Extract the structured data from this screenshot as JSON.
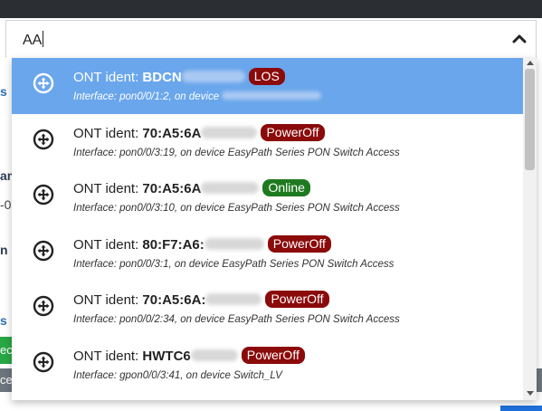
{
  "search": {
    "value": "AA"
  },
  "background": {
    "frag1": "s",
    "frag2": "am",
    "frag3": "-0(",
    "frag4": "n ",
    "frag5": "s",
    "green_btn": "ec",
    "grey_btn": "ce"
  },
  "results": [
    {
      "prefix": "ONT ident: ",
      "ident": "BDCN",
      "status": "LOS",
      "status_type": "los",
      "interface": "Interface: pon0/0/1:2, on device ",
      "active": true
    },
    {
      "prefix": "ONT ident: ",
      "ident": "70:A5:6A",
      "status": "PowerOff",
      "status_type": "poweroff",
      "interface": "Interface: pon0/0/3:19, on device EasyPath Series PON Switch Access",
      "active": false
    },
    {
      "prefix": "ONT ident: ",
      "ident": "70:A5:6A",
      "status": "Online",
      "status_type": "online",
      "interface": "Interface: pon0/0/3:10, on device EasyPath Series PON Switch Access",
      "active": false
    },
    {
      "prefix": "ONT ident: ",
      "ident": "80:F7:A6:",
      "status": "PowerOff",
      "status_type": "poweroff",
      "interface": "Interface: pon0/0/3:1, on device EasyPath Series PON Switch Access",
      "active": false
    },
    {
      "prefix": "ONT ident: ",
      "ident": "70:A5:6A:",
      "status": "PowerOff",
      "status_type": "poweroff",
      "interface": "Interface: pon0/0/2:34, on device EasyPath Series PON Switch Access",
      "active": false
    },
    {
      "prefix": "ONT ident: ",
      "ident": "HWTC6",
      "status": "PowerOff",
      "status_type": "poweroff",
      "interface": "Interface: gpon0/0/3:41, on device Switch_LV",
      "active": false
    }
  ],
  "colors": {
    "highlight": "#6aa6ec",
    "los": "#8b0a0a",
    "poweroff": "#8b0a0a",
    "online": "#1f7a1f"
  },
  "icons": {
    "chevron": "chevron-up-icon",
    "device": "move-arrows-icon"
  }
}
